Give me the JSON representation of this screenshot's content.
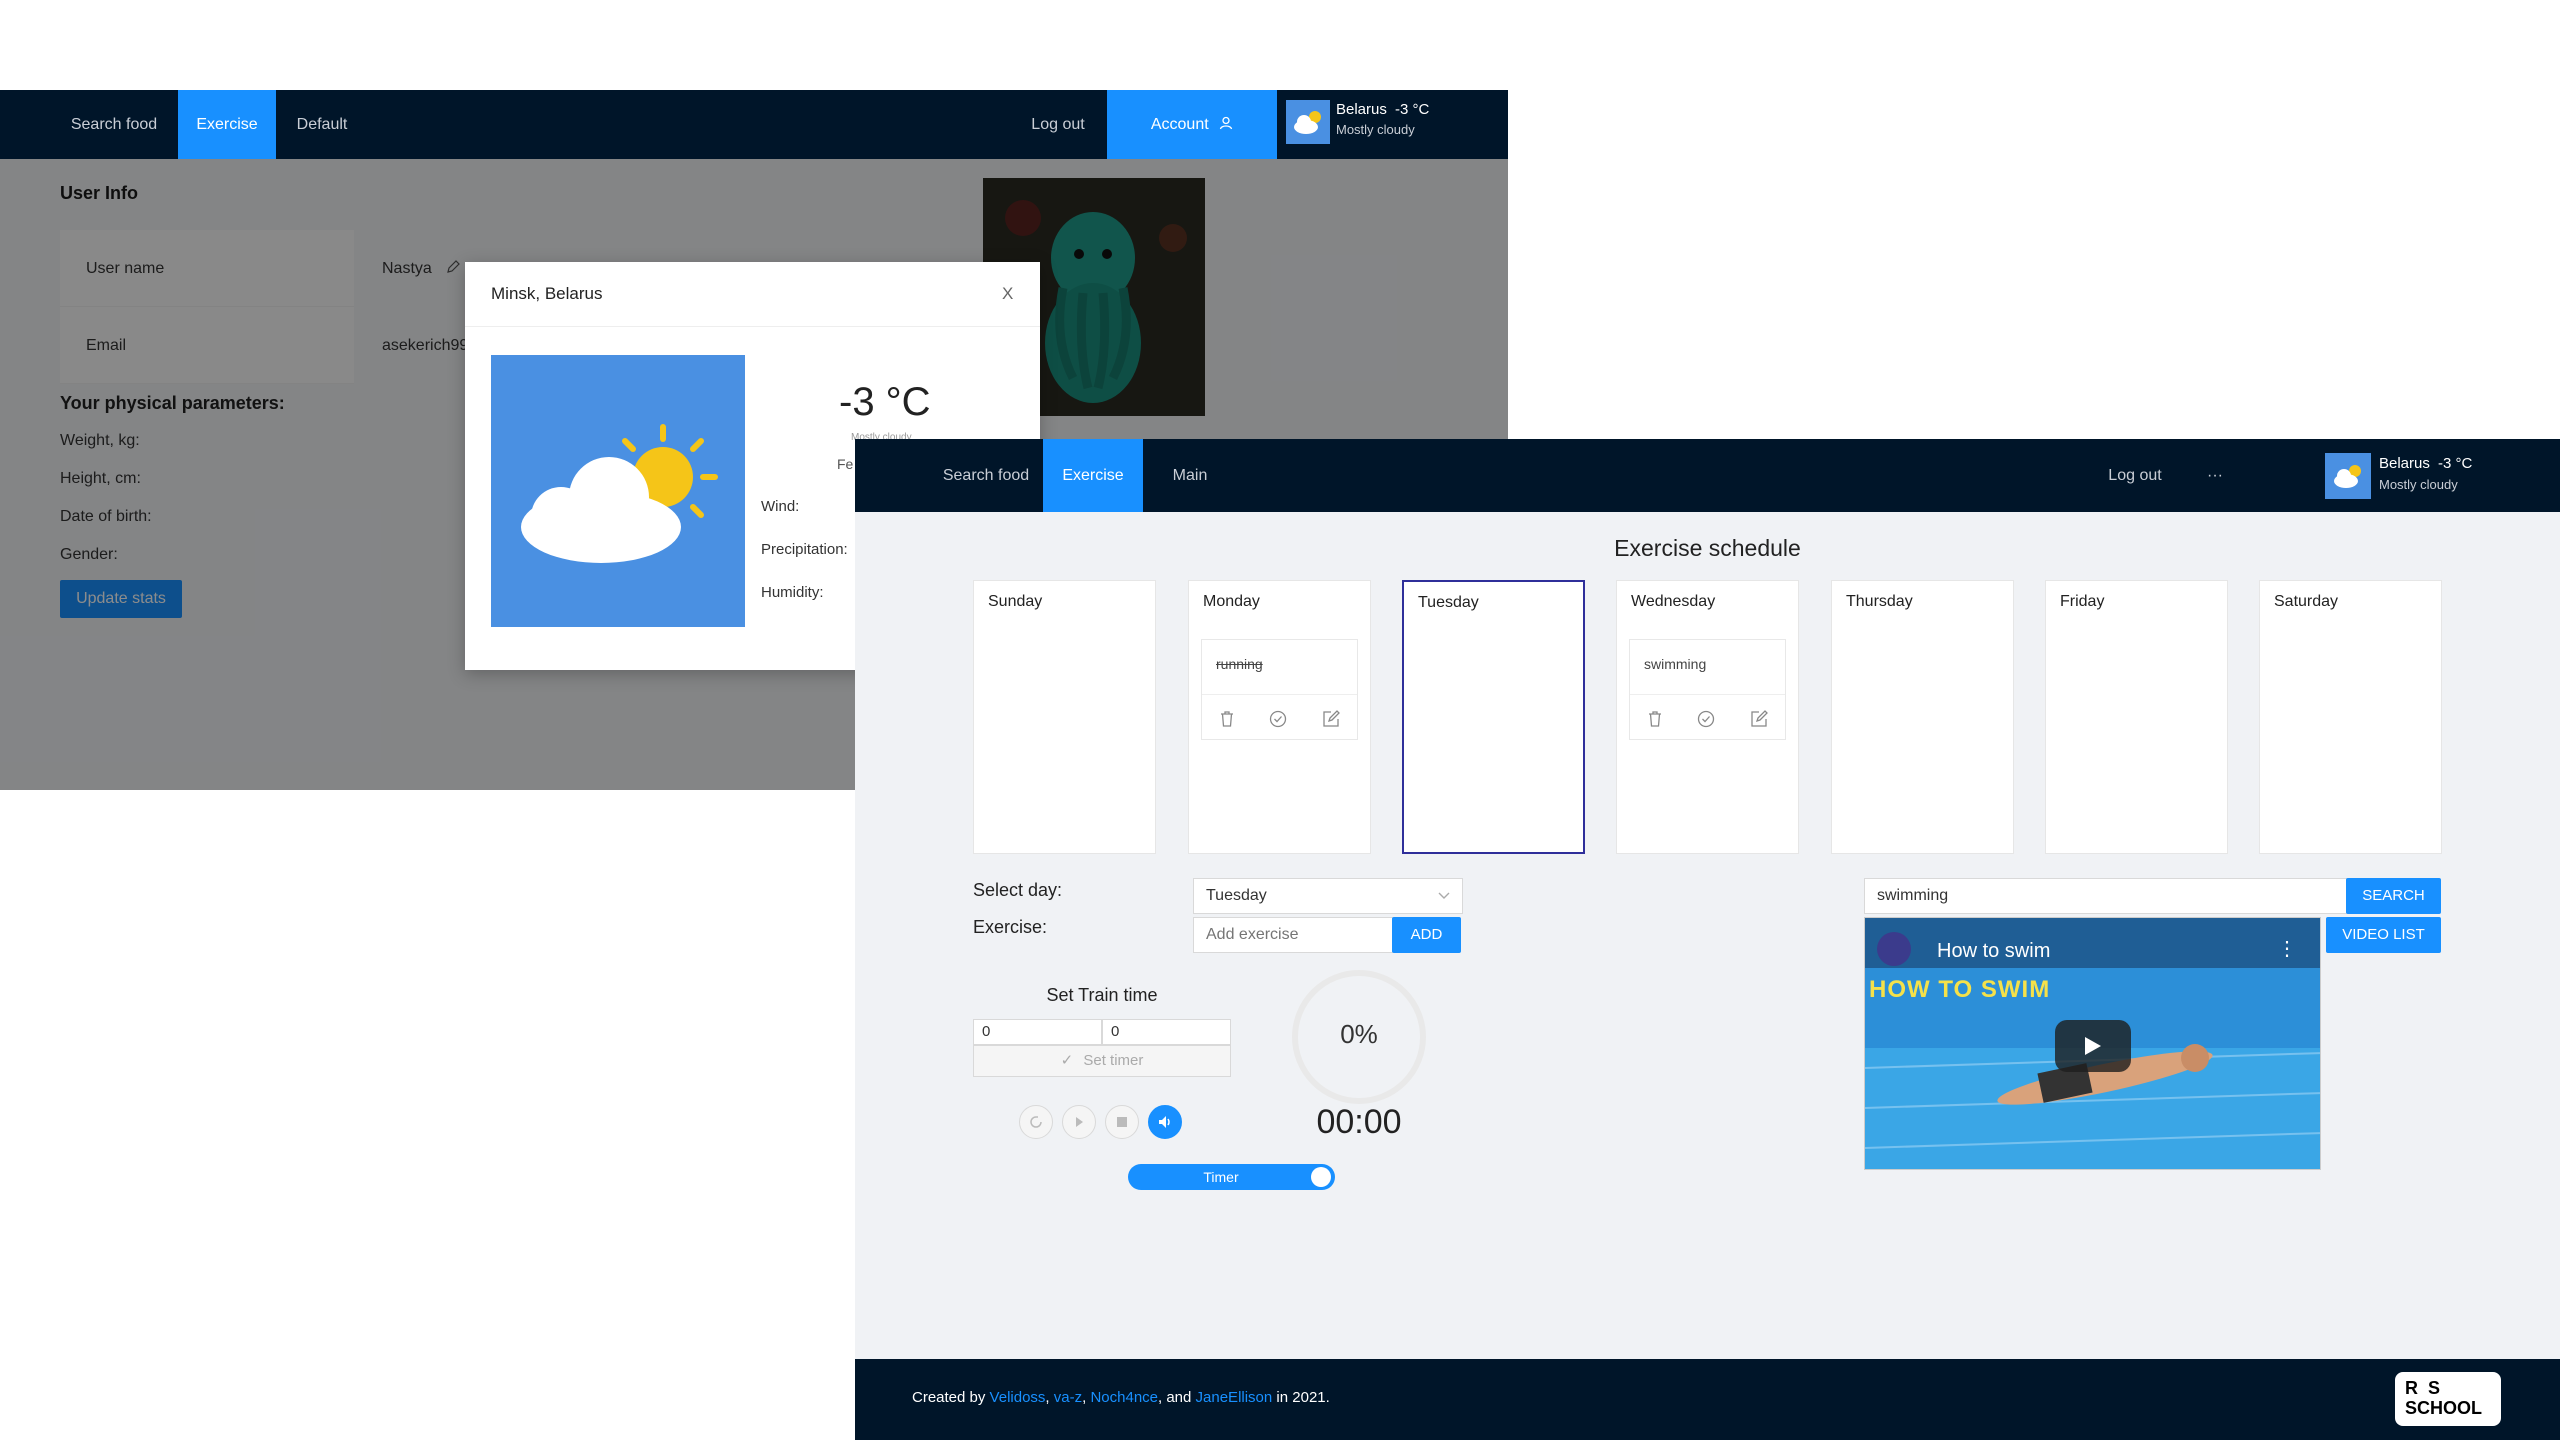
{
  "back_window": {
    "nav": {
      "items": [
        "Search food",
        "Exercise",
        "Default"
      ],
      "logout": "Log out",
      "account": "Account",
      "weather": {
        "location": "Belarus",
        "temp": "-3 °C",
        "desc": "Mostly cloudy"
      }
    },
    "user_info": {
      "title": "User Info",
      "rows": [
        {
          "label": "User name",
          "value": "Nastya"
        },
        {
          "label": "Email",
          "value": "asekerich99"
        }
      ],
      "params_title": "Your physical parameters:",
      "params": [
        "Weight, kg:",
        "Height, cm:",
        "Date of birth:",
        "Gender:"
      ],
      "update_button": "Update stats"
    },
    "weather_modal": {
      "title": "Minsk, Belarus",
      "close": "X",
      "temp": "-3 °C",
      "desc": "Mostly cloudy",
      "feels": "Fe",
      "rows": [
        "Wind:",
        "Precipitation:",
        "Humidity:"
      ]
    }
  },
  "front_window": {
    "nav": {
      "items": [
        "Search food",
        "Exercise",
        "Main"
      ],
      "logout": "Log out",
      "more": "···",
      "weather": {
        "location": "Belarus",
        "temp": "-3 °C",
        "desc": "Mostly cloudy"
      }
    },
    "schedule": {
      "title": "Exercise schedule",
      "days": [
        "Sunday",
        "Monday",
        "Tuesday",
        "Wednesday",
        "Thursday",
        "Friday",
        "Saturday"
      ],
      "selected_day": "Tuesday",
      "tasks": [
        {
          "day": "Monday",
          "name": "running",
          "done": true
        },
        {
          "day": "Wednesday",
          "name": "swimming",
          "done": false
        }
      ]
    },
    "form": {
      "select_day_label": "Select day:",
      "select_day_value": "Tuesday",
      "exercise_label": "Exercise:",
      "exercise_placeholder": "Add exercise",
      "add_button": "ADD"
    },
    "timer": {
      "title": "Set Train time",
      "minutes": "0",
      "seconds": "0",
      "set_timer": "Set timer",
      "progress": "0%",
      "progress_value": 0,
      "time": "00:00",
      "toggle_label": "Timer",
      "toggle_on": true
    },
    "video": {
      "search_value": "swimming",
      "search_button": "SEARCH",
      "video_list_button": "VIDEO LIST",
      "video_title": "How to swim",
      "thumbnail_text": "HOW TO SWIM"
    },
    "footer": {
      "prefix": "Created by ",
      "authors": [
        "Velidoss",
        "va-z",
        "Noch4nce",
        "JaneEllison"
      ],
      "sep1": ", ",
      "sep2": ", ",
      "sep3": ", and ",
      "suffix": " in 2021.",
      "logo_line1": "R  S",
      "logo_line2": "SCHOOL"
    }
  },
  "colors": {
    "accent": "#1890ff",
    "nav_bg": "#001529",
    "page_bg": "#f0f2f5",
    "selected_border": "#2f2f9a"
  }
}
